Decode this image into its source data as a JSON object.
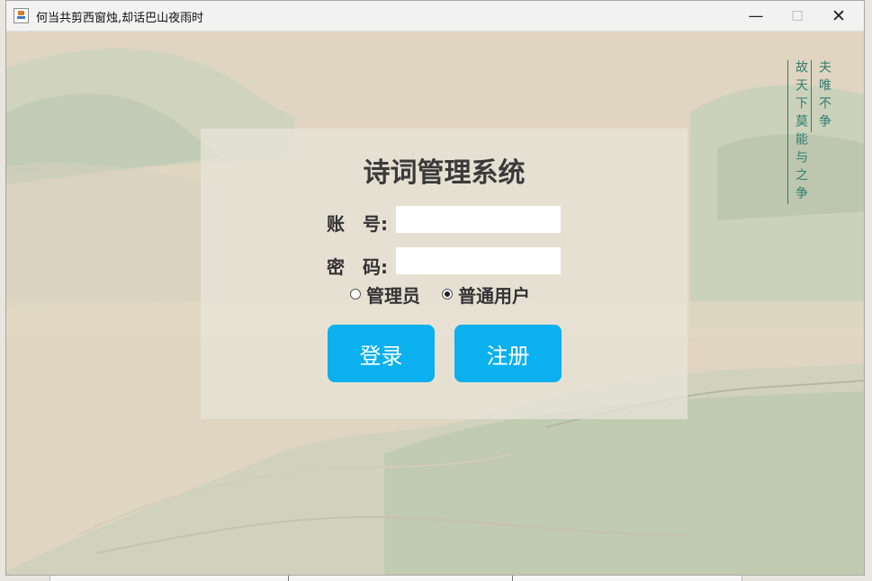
{
  "window": {
    "title": "何当共剪西窗烛,却话巴山夜雨时",
    "controls": {
      "minimize": "—",
      "maximize": "☐",
      "close": "✕"
    }
  },
  "decoration": {
    "calligraphy_col1": "夫唯不争",
    "calligraphy_col2": "故天下莫能与之争"
  },
  "login": {
    "title": "诗词管理系统",
    "account_label": "账　号:",
    "password_label": "密　码:",
    "account_value": "",
    "password_value": "",
    "roles": [
      {
        "label": "管理员",
        "checked": false
      },
      {
        "label": "普通用户",
        "checked": true
      }
    ],
    "login_button": "登录",
    "register_button": "注册"
  },
  "colors": {
    "button": "#0bb0ef",
    "calligraphy": "#2f7d72",
    "background": "#dfd4bf"
  }
}
